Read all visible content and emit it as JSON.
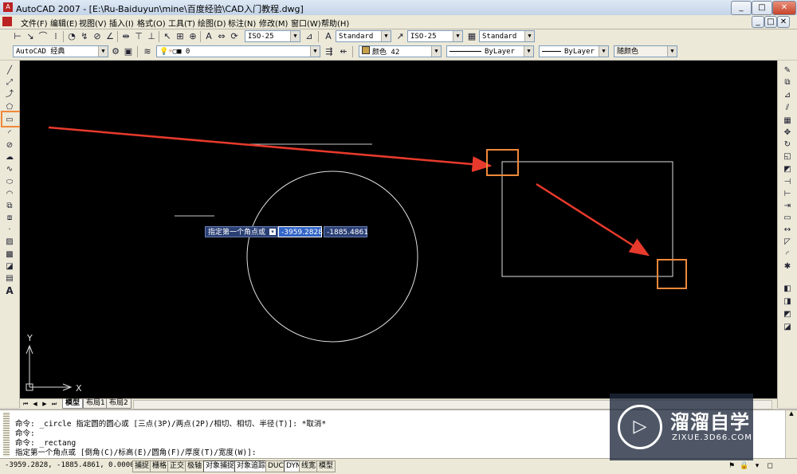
{
  "window": {
    "title": "AutoCAD 2007 - [E:\\Ru-Baiduyun\\mine\\百度经验\\CAD入门教程.dwg]",
    "app_icon": "autocad-icon",
    "min": "_",
    "max": "□",
    "close": "✕",
    "doc_min": "_",
    "doc_max": "□",
    "doc_close": "✕"
  },
  "menu": [
    "文件(F)",
    "编辑(E)",
    "视图(V)",
    "插入(I)",
    "格式(O)",
    "工具(T)",
    "绘图(D)",
    "标注(N)",
    "修改(M)",
    "窗口(W)",
    "帮助(H)"
  ],
  "toolbar1": {
    "dimstyle": "ISO-25",
    "textstyle": "Standard",
    "dimstyle2": "ISO-25",
    "tablestyle": "Standard"
  },
  "toolbar2": {
    "workspace": "AutoCAD 经典",
    "layer": "0",
    "color": "颜色 42",
    "linetype": "ByLayer",
    "lineweight": "ByLayer",
    "plotstyle": "随颜色"
  },
  "dynamic_input": {
    "prompt": "指定第一个角点或",
    "x": "-3959.2828",
    "y": "-1885.4861"
  },
  "ucs": {
    "x_label": "X",
    "y_label": "Y"
  },
  "tabs": {
    "model": "模型",
    "layout1": "布局1",
    "layout2": "布局2"
  },
  "command_lines": [
    "命令: _circle 指定圆的圆心或 [三点(3P)/两点(2P)/相切、相切、半径(T)]: *取消*",
    "命令:",
    "命令: _rectang",
    "指定第一个角点或 [倒角(C)/标高(E)/圆角(F)/厚度(T)/宽度(W)]:"
  ],
  "status": {
    "coords": "-3959.2828, -1885.4861, 0.0000",
    "buttons": [
      "捕捉",
      "栅格",
      "正交",
      "极轴",
      "对象捕捉",
      "对象追踪",
      "DUCS",
      "DYN",
      "线宽",
      "模型"
    ]
  },
  "watermark": {
    "title": "溜溜自学",
    "url": "ZIXUE.3D66.COM",
    "logo": "play-icon"
  },
  "colors": {
    "canvas": "#000000",
    "highlight": "#f0883a",
    "arrow": "#e83a2c",
    "geometry": "#ffffff"
  }
}
